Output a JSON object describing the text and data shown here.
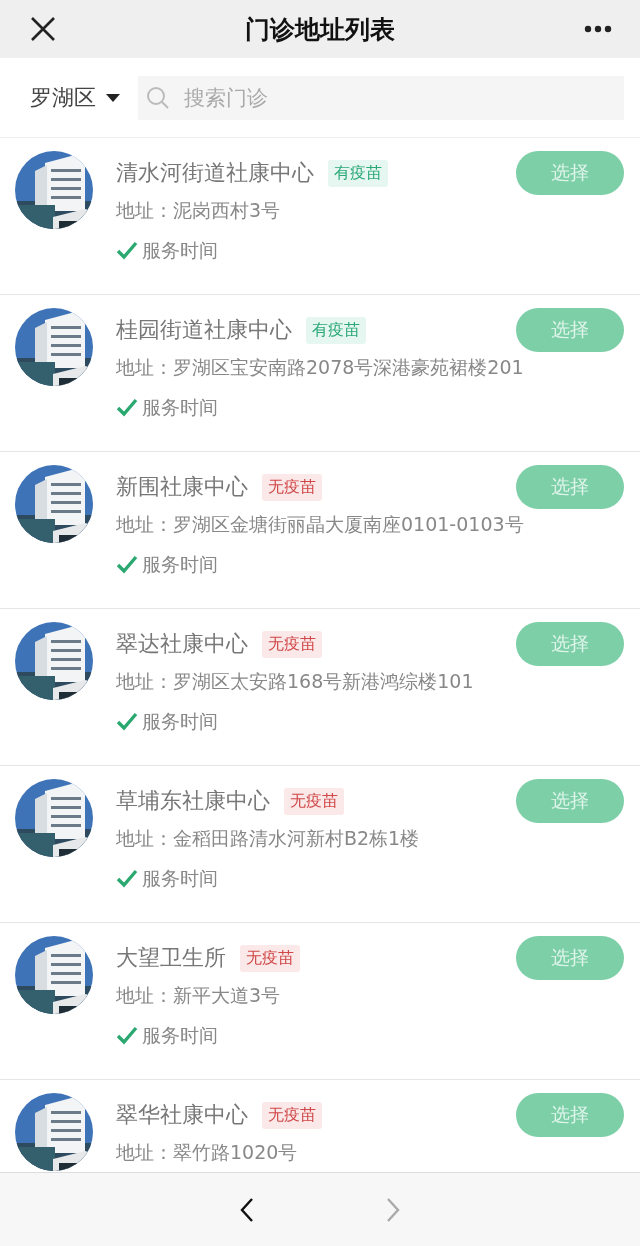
{
  "header": {
    "title": "门诊地址列表"
  },
  "filter": {
    "district": "罗湖区",
    "placeholder": "搜索门诊"
  },
  "clinics": [
    {
      "name": "清水河街道社康中心",
      "tag": {
        "text": "有疫苗",
        "available": true
      },
      "address": "地址：泥岗西村3号",
      "service_time": "服务时间",
      "button": "选择"
    },
    {
      "name": "桂园街道社康中心",
      "tag": {
        "text": "有疫苗",
        "available": true
      },
      "address": "地址：罗湖区宝安南路2078号深港豪苑裙楼201",
      "service_time": "服务时间",
      "button": "选择"
    },
    {
      "name": "新围社康中心",
      "tag": {
        "text": "无疫苗",
        "available": false
      },
      "address": "地址：罗湖区金塘街丽晶大厦南座0101-0103号",
      "service_time": "服务时间",
      "button": "选择"
    },
    {
      "name": "翠达社康中心",
      "tag": {
        "text": "无疫苗",
        "available": false
      },
      "address": "地址：罗湖区太安路168号新港鸿综楼101",
      "service_time": "服务时间",
      "button": "选择"
    },
    {
      "name": "草埔东社康中心",
      "tag": {
        "text": "无疫苗",
        "available": false
      },
      "address": "地址：金稻田路清水河新村B2栋1楼",
      "service_time": "服务时间",
      "button": "选择"
    },
    {
      "name": "大望卫生所",
      "tag": {
        "text": "无疫苗",
        "available": false
      },
      "address": "地址：新平大道3号",
      "service_time": "服务时间",
      "button": "选择"
    },
    {
      "name": "翠华社康中心",
      "tag": {
        "text": "无疫苗",
        "available": false
      },
      "address": "地址：翠竹路1020号",
      "button": "选择"
    }
  ],
  "nav": [
    {
      "kind": "back",
      "disabled": false
    },
    {
      "kind": "forward",
      "disabled": true
    }
  ]
}
